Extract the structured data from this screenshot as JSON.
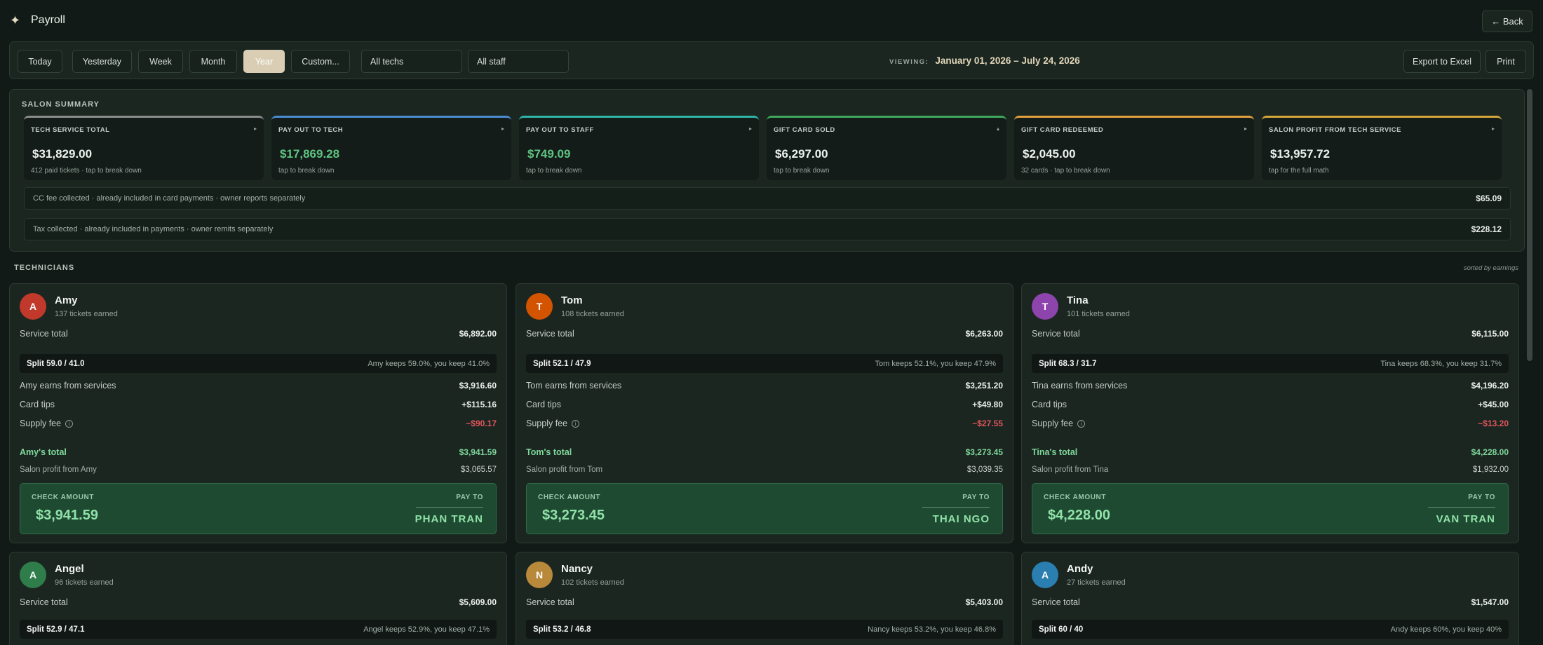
{
  "app": {
    "title": "Payroll",
    "back_label": "← Back"
  },
  "filters": {
    "ranges": [
      "Today",
      "Yesterday",
      "Week",
      "Month",
      "Year",
      "Custom..."
    ],
    "active_range": "Year",
    "tech_select": "All techs",
    "staff_select": "All staff",
    "viewing_label": "VIEWING:",
    "viewing_range": "January 01, 2026 – July 24, 2026",
    "export_label": "Export to Excel",
    "print_label": "Print"
  },
  "summary": {
    "title": "SALON SUMMARY",
    "cards": [
      {
        "label": "TECH SERVICE TOTAL",
        "value": "$31,829.00",
        "sub": "412 paid tickets · tap to break down",
        "accent": "#8c8c8c",
        "value_color": "#eef2ef",
        "arrow": "▸"
      },
      {
        "label": "PAY OUT TO TECH",
        "value": "$17,869.28",
        "sub": "tap to break down",
        "accent": "#4a8ccf",
        "value_color": "#5fc482",
        "arrow": "▸"
      },
      {
        "label": "PAY OUT TO STAFF",
        "value": "$749.09",
        "sub": "tap to break down",
        "accent": "#2fb5a8",
        "value_color": "#5fc482",
        "arrow": "▸"
      },
      {
        "label": "GIFT CARD SOLD",
        "value": "$6,297.00",
        "sub": "tap to break down",
        "accent": "#3fa75c",
        "value_color": "#eef2ef",
        "arrow": "▴"
      },
      {
        "label": "GIFT CARD REDEEMED",
        "value": "$2,045.00",
        "sub": "32 cards · tap to break down",
        "accent": "#e0a040",
        "value_color": "#eef2ef",
        "arrow": "▸"
      },
      {
        "label": "SALON PROFIT FROM TECH SERVICE",
        "value": "$13,957.72",
        "sub": "tap for the full math",
        "accent": "#d4a63a",
        "value_color": "#eef2ef",
        "arrow": "▸"
      }
    ],
    "cc_fee": {
      "label": "CC fee collected · already included in card payments · owner reports separately",
      "value": "$65.09"
    },
    "tax": {
      "label": "Tax collected · already included in payments · owner remits separately",
      "value": "$228.12"
    }
  },
  "technicians": {
    "title": "TECHNICIANS",
    "sort_note": "sorted by earnings",
    "items": [
      {
        "initial": "A",
        "color": "#c0392b",
        "name": "Amy",
        "tickets": "137 tickets earned",
        "service_label": "Service total",
        "service_total": "$6,892.00",
        "split": "Split 59.0 / 41.0",
        "split_desc": "Amy keeps 59.0%, you keep 41.0%",
        "earns_label": "Amy earns from services",
        "earns": "$3,916.60",
        "tips_label": "Card tips",
        "tips": "+$115.16",
        "supply_label": "Supply fee",
        "supply": "−$90.17",
        "total_label": "Amy's total",
        "total": "$3,941.59",
        "profit_label": "Salon profit from Amy",
        "profit": "$3,065.57",
        "check_label": "CHECK AMOUNT",
        "check_amount": "$3,941.59",
        "payto_label": "PAY TO",
        "payto": "PHAN TRAN"
      },
      {
        "initial": "T",
        "color": "#d35400",
        "name": "Tom",
        "tickets": "108 tickets earned",
        "service_label": "Service total",
        "service_total": "$6,263.00",
        "split": "Split 52.1 / 47.9",
        "split_desc": "Tom keeps 52.1%, you keep 47.9%",
        "earns_label": "Tom earns from services",
        "earns": "$3,251.20",
        "tips_label": "Card tips",
        "tips": "+$49.80",
        "supply_label": "Supply fee",
        "supply": "−$27.55",
        "total_label": "Tom's total",
        "total": "$3,273.45",
        "profit_label": "Salon profit from Tom",
        "profit": "$3,039.35",
        "check_label": "CHECK AMOUNT",
        "check_amount": "$3,273.45",
        "payto_label": "PAY TO",
        "payto": "THAI NGO"
      },
      {
        "initial": "T",
        "color": "#8e44ad",
        "name": "Tina",
        "tickets": "101 tickets earned",
        "service_label": "Service total",
        "service_total": "$6,115.00",
        "split": "Split 68.3 / 31.7",
        "split_desc": "Tina keeps 68.3%, you keep 31.7%",
        "earns_label": "Tina earns from services",
        "earns": "$4,196.20",
        "tips_label": "Card tips",
        "tips": "+$45.00",
        "supply_label": "Supply fee",
        "supply": "−$13.20",
        "total_label": "Tina's total",
        "total": "$4,228.00",
        "profit_label": "Salon profit from Tina",
        "profit": "$1,932.00",
        "check_label": "CHECK AMOUNT",
        "check_amount": "$4,228.00",
        "payto_label": "PAY TO",
        "payto": "VAN TRAN"
      },
      {
        "initial": "A",
        "color": "#2e7d4a",
        "name": "Angel",
        "tickets": "96 tickets earned",
        "service_label": "Service total",
        "service_total": "$5,609.00",
        "split": "Split 52.9 / 47.1",
        "split_desc": "Angel keeps 52.9%, you keep 47.1%"
      },
      {
        "initial": "N",
        "color": "#b8893a",
        "name": "Nancy",
        "tickets": "102 tickets earned",
        "service_label": "Service total",
        "service_total": "$5,403.00",
        "split": "Split 53.2 / 46.8",
        "split_desc": "Nancy keeps 53.2%, you keep 46.8%"
      },
      {
        "initial": "A",
        "color": "#2a7fb0",
        "name": "Andy",
        "tickets": "27 tickets earned",
        "service_label": "Service total",
        "service_total": "$1,547.00",
        "split": "Split 60 / 40",
        "split_desc": "Andy keeps 60%, you keep 40%"
      }
    ]
  }
}
